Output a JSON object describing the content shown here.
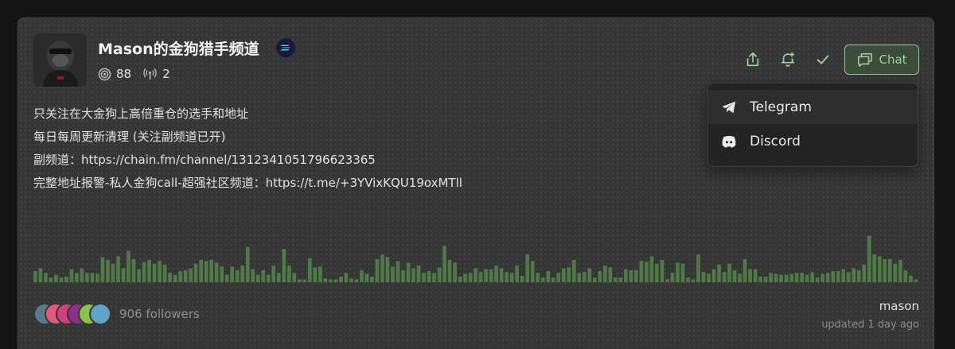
{
  "channel": {
    "title": "Mason的金狗猎手频道",
    "stat_subscribers": "88",
    "stat_broadcasts": "2",
    "description_lines": [
      "只关注在大金狗上高倍重仓的选手和地址",
      "每日每周更新清理 (关注副频道已开)",
      "副频道：https://chain.fm/channel/1312341051796623365",
      "完整地址报警-私人金狗call-超强社区频道：https://t.me/+3YVixKQU19oxMTll"
    ],
    "followers_text": "906 followers",
    "owner": "mason",
    "updated": "updated 1 day ago"
  },
  "actions": {
    "chat_label": "Chat",
    "menu": [
      {
        "label": "Telegram",
        "icon": "telegram-icon"
      },
      {
        "label": "Discord",
        "icon": "discord-icon"
      }
    ]
  },
  "activity": {
    "values": [
      12,
      15,
      10,
      5,
      8,
      5,
      6,
      14,
      10,
      15,
      10,
      10,
      9,
      27,
      24,
      20,
      28,
      15,
      34,
      25,
      14,
      22,
      24,
      20,
      23,
      19,
      10,
      8,
      12,
      13,
      15,
      20,
      24,
      23,
      24,
      21,
      17,
      8,
      17,
      13,
      18,
      38,
      14,
      8,
      13,
      8,
      18,
      10,
      36,
      18,
      10,
      3,
      3,
      26,
      16,
      17,
      4,
      3,
      3,
      6,
      10,
      4,
      3,
      13,
      9,
      6,
      25,
      30,
      27,
      17,
      23,
      13,
      21,
      15,
      18,
      10,
      12,
      10,
      16,
      39,
      24,
      21,
      6,
      9,
      10,
      15,
      11,
      14,
      14,
      18,
      15,
      11,
      10,
      18,
      7,
      30,
      23,
      10,
      5,
      12,
      5,
      10,
      15,
      16,
      24,
      10,
      11,
      15,
      5,
      12,
      18,
      16,
      5,
      5,
      14,
      13,
      13,
      23,
      22,
      28,
      20,
      24,
      3,
      10,
      21,
      20,
      5,
      3,
      30,
      11,
      9,
      14,
      19,
      11,
      20,
      13,
      9,
      25,
      14,
      14,
      6,
      6,
      10,
      9,
      8,
      8,
      9,
      10,
      10,
      8,
      11,
      5,
      9,
      10,
      12,
      12,
      14,
      11,
      15,
      13,
      19,
      50,
      30,
      28,
      25,
      25,
      20,
      24,
      13,
      7,
      3
    ],
    "color": "#4f7a48"
  },
  "colors": {
    "accent": "#9ed49a",
    "card": "#363636"
  }
}
